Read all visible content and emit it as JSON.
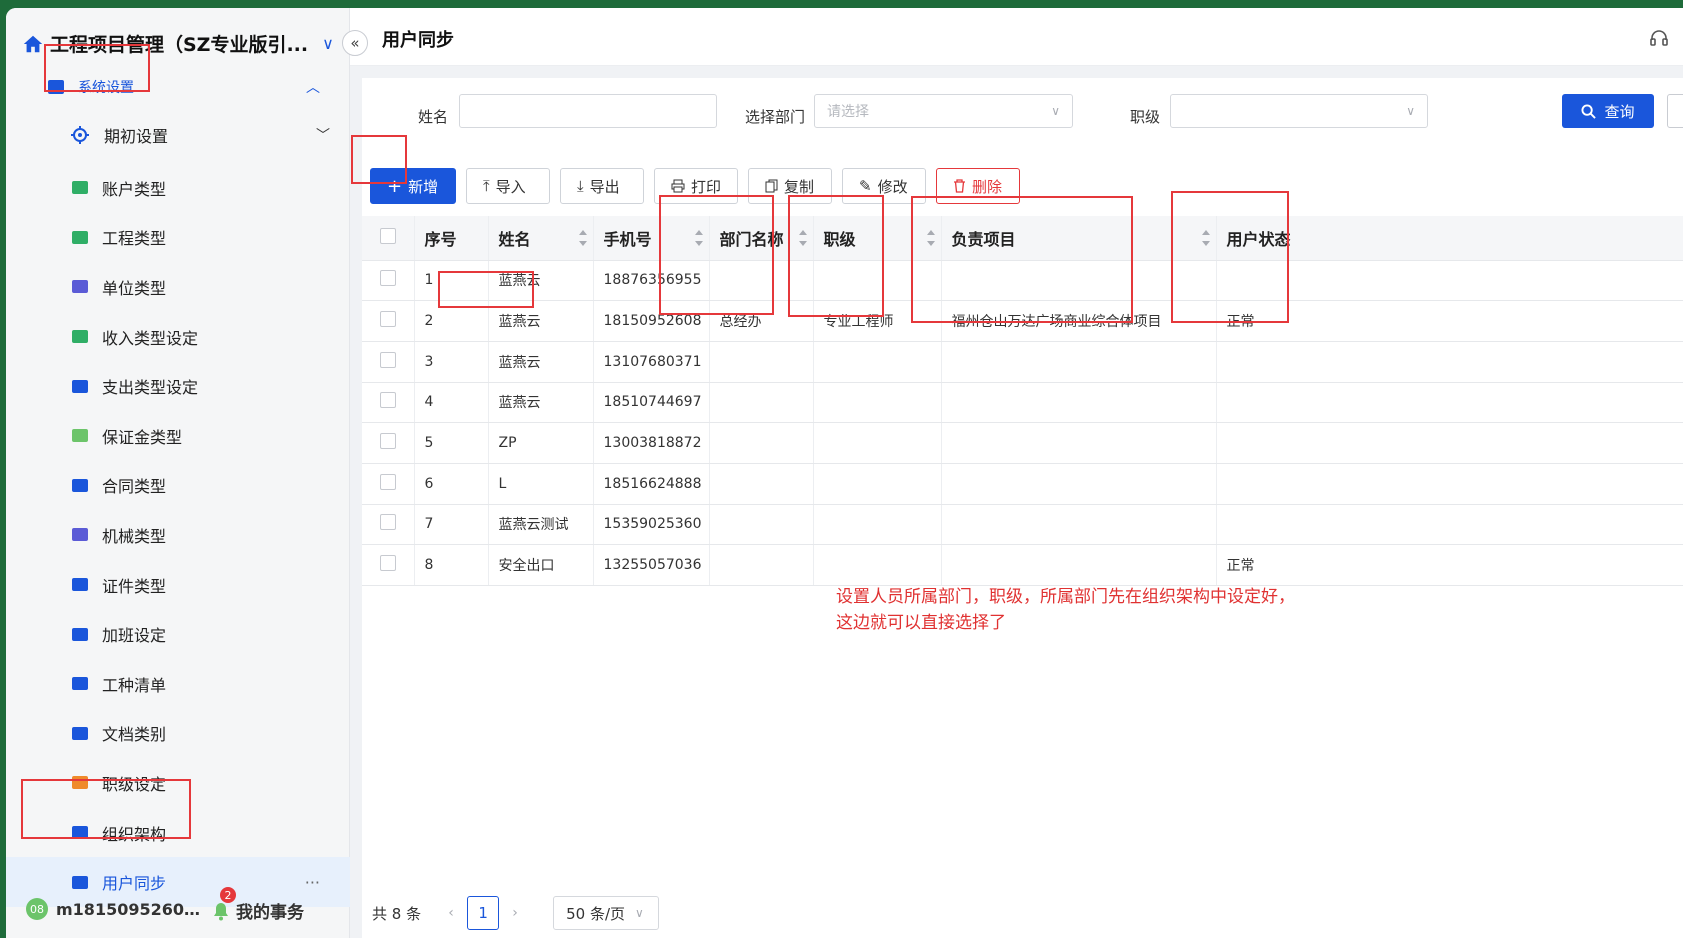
{
  "app": {
    "title": "工程项目管理（SZ专业版引..."
  },
  "sidebar": {
    "group": "系统设置",
    "submenu": "期初设置",
    "items": [
      {
        "label": "账户类型",
        "icon": "card-icon",
        "color": "#2fae66"
      },
      {
        "label": "工程类型",
        "icon": "tools-icon",
        "color": "#2fae66"
      },
      {
        "label": "单位类型",
        "icon": "r-badge-icon",
        "color": "#5b5bd6"
      },
      {
        "label": "收入类型设定",
        "icon": "table-icon",
        "color": "#2fae66"
      },
      {
        "label": "支出类型设定",
        "icon": "table-icon",
        "color": "#1a56db"
      },
      {
        "label": "保证金类型",
        "icon": "clipboard-icon",
        "color": "#6cc46a"
      },
      {
        "label": "合同类型",
        "icon": "folder-icon",
        "color": "#1a56db"
      },
      {
        "label": "机械类型",
        "icon": "machine-icon",
        "color": "#5b5bd6"
      },
      {
        "label": "证件类型",
        "icon": "id-strip-icon",
        "color": "#1a56db"
      },
      {
        "label": "加班设定",
        "icon": "coffee-icon",
        "color": "#1a56db"
      },
      {
        "label": "工种清单",
        "icon": "worker-icon",
        "color": "#1a56db"
      },
      {
        "label": "文档类别",
        "icon": "list-icon",
        "color": "#1a56db"
      },
      {
        "label": "职级设定",
        "icon": "badge-icon",
        "color": "#ef8a2a"
      },
      {
        "label": "组织架构",
        "icon": "org-icon",
        "color": "#1a56db"
      },
      {
        "label": "用户同步",
        "icon": "user-add-icon",
        "color": "#1a56db",
        "active": true
      }
    ],
    "user": {
      "avatar_text": "08",
      "name": "m1815095260…"
    },
    "todo": {
      "label": "我的事务",
      "count": "2"
    }
  },
  "header": {
    "page_title": "用户同步"
  },
  "filter": {
    "name_label": "姓名",
    "dept_label": "选择部门",
    "dept_placeholder": "请选择",
    "rank_label": "职级",
    "query_label": "查询"
  },
  "toolbar": {
    "add": "新增",
    "import": "导入",
    "export": "导出",
    "print": "打印",
    "copy": "复制",
    "edit": "修改",
    "delete": "删除"
  },
  "table": {
    "columns": [
      "序号",
      "姓名",
      "手机号",
      "部门名称",
      "职级",
      "负责项目",
      "用户状态"
    ],
    "rows": [
      {
        "no": "1",
        "name": "蓝燕云",
        "phone": "18876356955",
        "dept": "",
        "rank": "",
        "project": "",
        "status": ""
      },
      {
        "no": "2",
        "name": "蓝燕云",
        "phone": "18150952608",
        "dept": "总经办",
        "rank": "专业工程师",
        "project": "福州仓山万达广场商业综合体项目",
        "status": "正常"
      },
      {
        "no": "3",
        "name": "蓝燕云",
        "phone": "13107680371",
        "dept": "",
        "rank": "",
        "project": "",
        "status": ""
      },
      {
        "no": "4",
        "name": "蓝燕云",
        "phone": "18510744697",
        "dept": "",
        "rank": "",
        "project": "",
        "status": ""
      },
      {
        "no": "5",
        "name": "ZP",
        "phone": "13003818872",
        "dept": "",
        "rank": "",
        "project": "",
        "status": ""
      },
      {
        "no": "6",
        "name": "L",
        "phone": "18516624888",
        "dept": "",
        "rank": "",
        "project": "",
        "status": ""
      },
      {
        "no": "7",
        "name": "蓝燕云测试",
        "phone": "15359025360",
        "dept": "",
        "rank": "",
        "project": "",
        "status": ""
      },
      {
        "no": "8",
        "name": "安全出口",
        "phone": "13255057036",
        "dept": "",
        "rank": "",
        "project": "",
        "status": "正常"
      }
    ]
  },
  "annotation": {
    "line1": "设置人员所属部门，职级，所属部门先在组织架构中设定好，",
    "line2": "这边就可以直接选择了"
  },
  "pagination": {
    "total": "共 8 条",
    "current": "1",
    "page_size": "50 条/页"
  },
  "colors": {
    "accent": "#1a56db",
    "danger": "#e5383b",
    "annotation": "#e03131"
  }
}
